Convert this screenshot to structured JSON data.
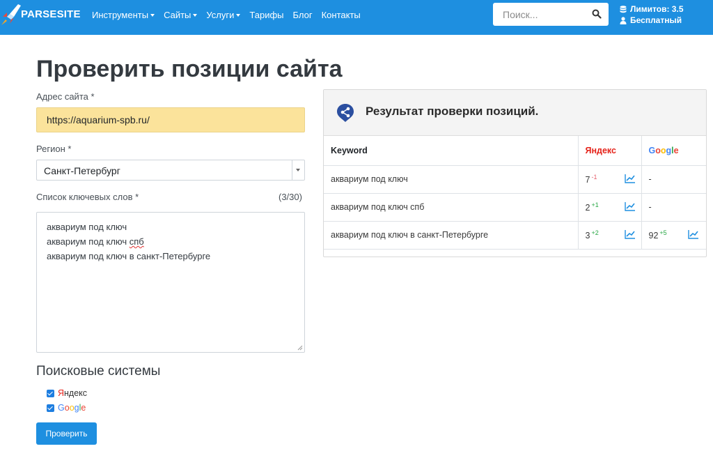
{
  "navbar": {
    "brand": "PARSESITE",
    "menu": [
      {
        "label": "Инструменты",
        "dropdown": true
      },
      {
        "label": "Сайты",
        "dropdown": true
      },
      {
        "label": "Услуги",
        "dropdown": true
      },
      {
        "label": "Тарифы",
        "dropdown": false
      },
      {
        "label": "Блог",
        "dropdown": false
      },
      {
        "label": "Контакты",
        "dropdown": false
      }
    ],
    "search_placeholder": "Поиск...",
    "limits_label": "Лимитов: 3.5",
    "plan_label": "Бесплатный"
  },
  "form": {
    "title": "Проверить позиции сайта",
    "url_label": "Адрес сайта *",
    "url_value": "https://aquarium-spb.ru/",
    "region_label": "Регион *",
    "region_value": "Санкт-Петербург",
    "keywords_label": "Список ключевых слов *",
    "keywords_count": "(3/30)",
    "keywords": [
      "аквариум под ключ",
      "аквариум под ключ спб",
      "аквариум под ключ в санкт-Петербурге"
    ],
    "engines_title": "Поисковые системы",
    "engine_yandex": "Яндекс",
    "engine_google": "Google",
    "submit_label": "Проверить"
  },
  "results": {
    "title": "Результат проверки позиций.",
    "col_keyword": "Keyword",
    "col_yandex": "Яндекс",
    "col_google": "Google",
    "rows": [
      {
        "keyword": "аквариум под ключ",
        "yandex": "7",
        "yandex_delta": "-1",
        "google": "-",
        "google_delta": ""
      },
      {
        "keyword": "аквариум под ключ спб",
        "yandex": "2",
        "yandex_delta": "+1",
        "google": "-",
        "google_delta": ""
      },
      {
        "keyword": "аквариум под ключ в санкт-Петербурге",
        "yandex": "3",
        "yandex_delta": "+2",
        "google": "92",
        "google_delta": "+5"
      }
    ]
  },
  "colors": {
    "navbar": "#1e8fe0",
    "url_highlight": "#fbe39b",
    "delta_negative": "#e4606d",
    "delta_positive": "#28a745"
  },
  "icons": [
    "rocket-logo-icon",
    "search-icon",
    "database-icon",
    "user-icon",
    "caret-down-icon",
    "share-icon",
    "trend-chart-icon",
    "checkbox-checked-icon"
  ]
}
